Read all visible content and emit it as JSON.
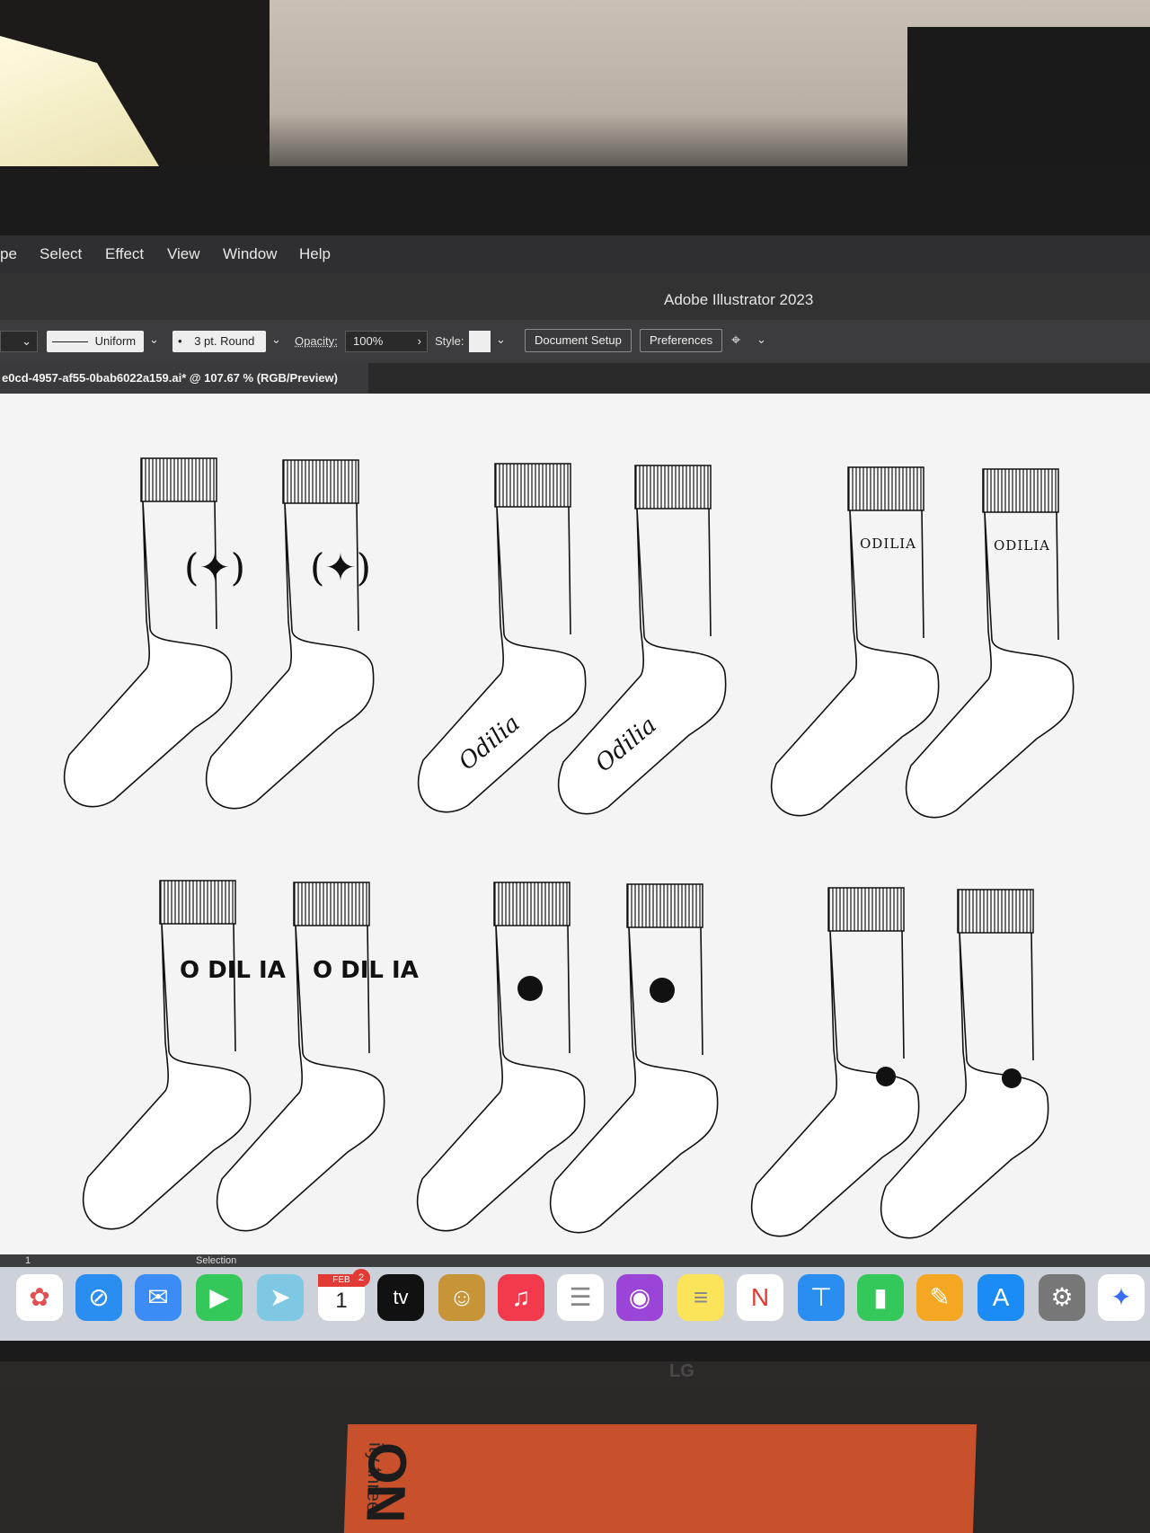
{
  "menu": {
    "items": [
      "pe",
      "Select",
      "Effect",
      "View",
      "Window",
      "Help"
    ]
  },
  "app_title": "Adobe Illustrator 2023",
  "control_bar": {
    "stroke_profile": "Uniform",
    "brush": "3 pt. Round",
    "opacity_label": "Opacity:",
    "opacity_value": "100%",
    "style_label": "Style:",
    "document_setup": "Document Setup",
    "preferences": "Preferences"
  },
  "document_tab": {
    "title": "e0cd-4957-af55-0bab6022a159.ai* @ 107.67 % (RGB/Preview)"
  },
  "artboard": {
    "sock_designs": [
      {
        "label": "",
        "pair": 1
      },
      {
        "label": "Odilia",
        "pair": 2
      },
      {
        "label": "ODILIA",
        "pair": 3
      },
      {
        "label": "O DIL IA",
        "pair": 4
      },
      {
        "label": "",
        "pair": 5
      },
      {
        "label": "",
        "pair": 6
      }
    ]
  },
  "status_bar": {
    "page": "1",
    "tool": "Selection"
  },
  "dock": {
    "calendar_month": "FEB",
    "calendar_day": "1",
    "calendar_badge": "2",
    "tv_label": "tv",
    "icons": [
      "photos-icon",
      "safari-icon",
      "mail-icon",
      "facetime-icon",
      "maps-icon",
      "calendar-icon",
      "apple-tv-icon",
      "contacts-icon",
      "music-icon",
      "reminders-icon",
      "podcasts-icon",
      "notes-icon",
      "news-icon",
      "keynote-icon",
      "numbers-icon",
      "pages-icon",
      "app-store-icon",
      "system-settings-icon",
      "freeform-icon"
    ]
  },
  "monitor_brand": "LG",
  "book": {
    "large_text": "ON",
    "small_text": "ity three"
  }
}
